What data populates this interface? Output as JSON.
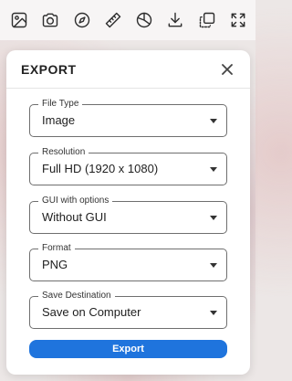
{
  "toolbar": {
    "icons": [
      "image-icon",
      "camera-icon",
      "compass-icon",
      "ruler-icon",
      "chart-pie-icon",
      "download-icon",
      "copy-icon",
      "fullscreen-icon"
    ]
  },
  "dialog": {
    "title": "EXPORT",
    "fields": [
      {
        "label": "File Type",
        "value": "Image"
      },
      {
        "label": "Resolution",
        "value": "Full HD (1920 x 1080)"
      },
      {
        "label": "GUI with options",
        "value": "Without GUI"
      },
      {
        "label": "Format",
        "value": "PNG"
      },
      {
        "label": "Save Destination",
        "value": "Save on Computer"
      }
    ],
    "export_label": "Export"
  },
  "colors": {
    "accent": "#1f74dd"
  }
}
